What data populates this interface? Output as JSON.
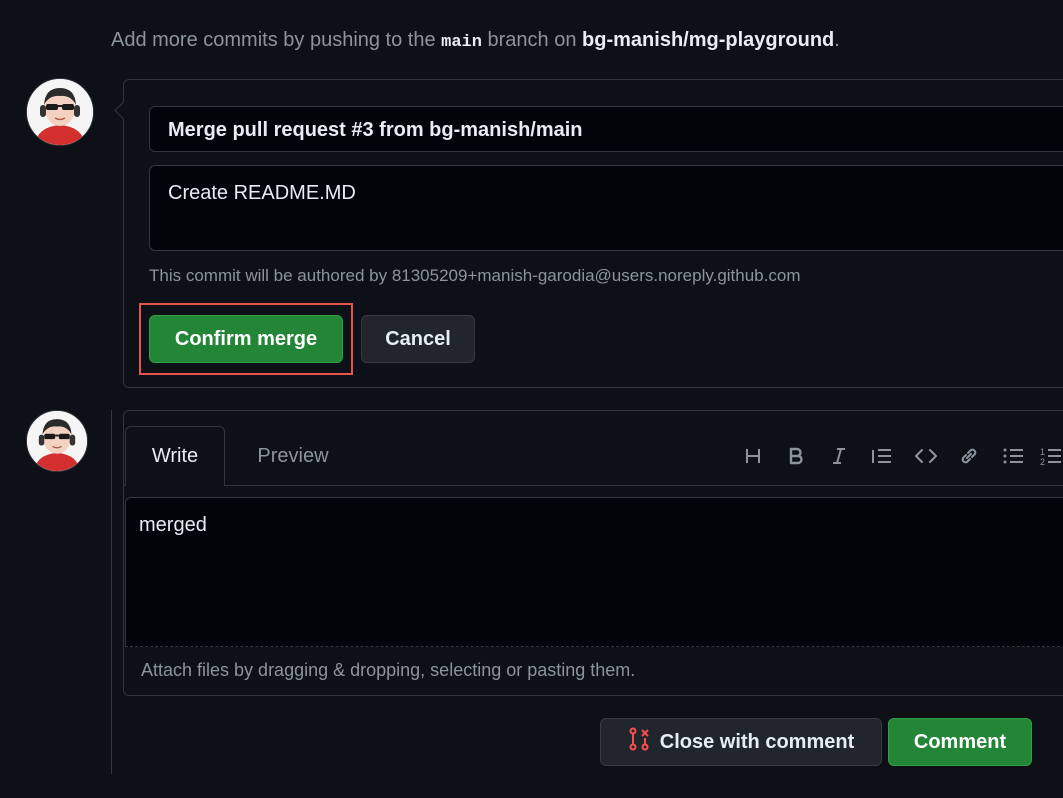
{
  "hint": {
    "prefix": "Add more commits by pushing to the ",
    "branch": "main",
    "middle": " branch on ",
    "repo": "bg-manish/mg-playground",
    "suffix": "."
  },
  "merge_form": {
    "title_value": "Merge pull request #3 from bg-manish/main",
    "description_value": "Create README.MD",
    "author_note": "This commit will be authored by 81305209+manish-garodia@users.noreply.github.com",
    "confirm_label": "Confirm merge",
    "cancel_label": "Cancel"
  },
  "comment_form": {
    "tabs": [
      "Write",
      "Preview"
    ],
    "toolbar_icons": [
      "heading-icon",
      "bold-icon",
      "italic-icon",
      "quote-icon",
      "code-icon",
      "link-icon",
      "unordered-list-icon",
      "ordered-list-icon"
    ],
    "editor_value": "merged",
    "attach_hint": "Attach files by dragging & dropping, selecting or pasting them.",
    "close_label": "Close with comment",
    "comment_label": "Comment"
  },
  "colors": {
    "background": "#0d1117",
    "border": "#30363d",
    "primary_green": "#238636",
    "highlight_red": "#e5534b",
    "close_icon_red": "#f85149"
  }
}
